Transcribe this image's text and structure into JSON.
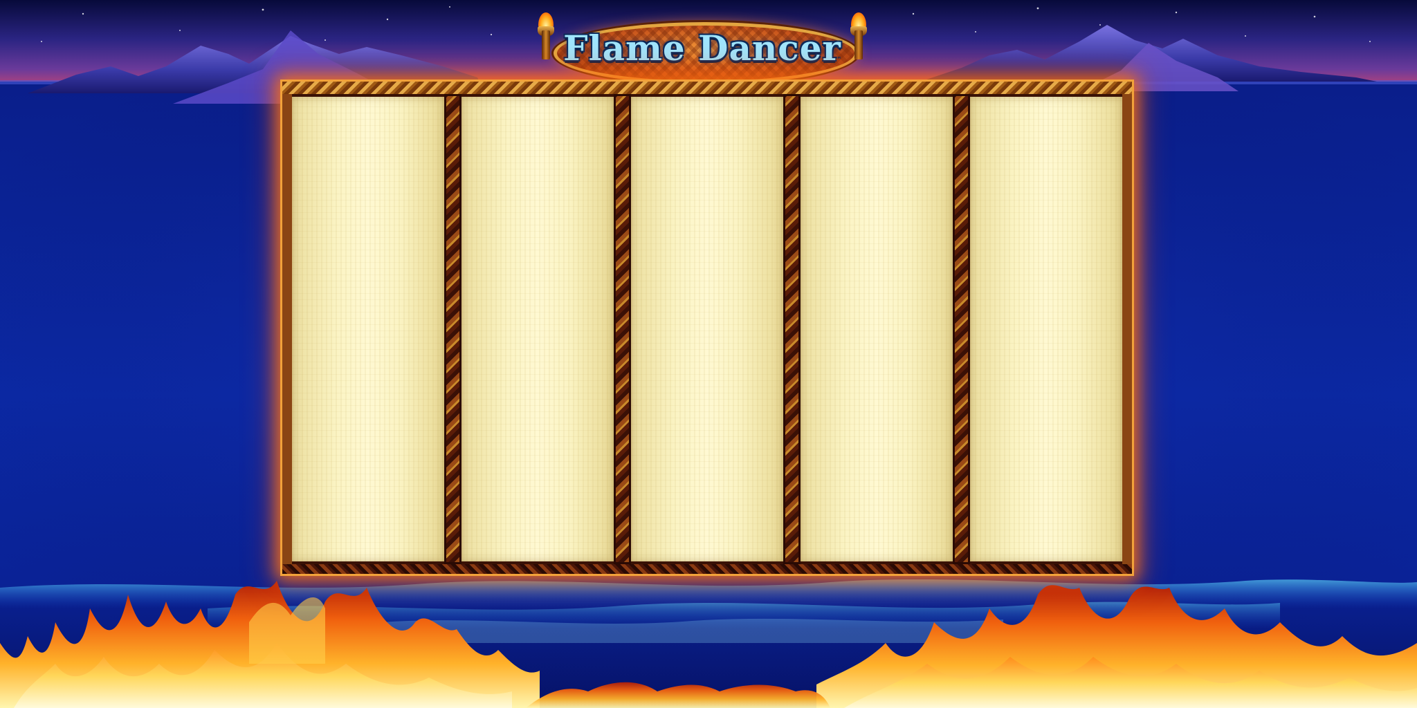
{
  "game": {
    "title": "Flame Dancer",
    "trademark": "™"
  },
  "reels": {
    "count": 5
  },
  "colors": {
    "sky_top": "#0a0e44",
    "sky_mid": "#3a2a8a",
    "sky_glow": "#c23a6a",
    "sea": "#0b2aa0",
    "sea_deep": "#061470",
    "mountain": "#4a4ab8",
    "reel_paper": "#fbf4c4",
    "frame_gold": "#c98a2a",
    "frame_dark": "#4a1608",
    "flame_core": "#fff3a0",
    "flame_mid": "#ffa020",
    "flame_outer": "#e0400a",
    "logo_text": "#9fe6ff"
  },
  "icons": {
    "left_torch": "torch-icon",
    "right_torch": "torch-icon"
  }
}
